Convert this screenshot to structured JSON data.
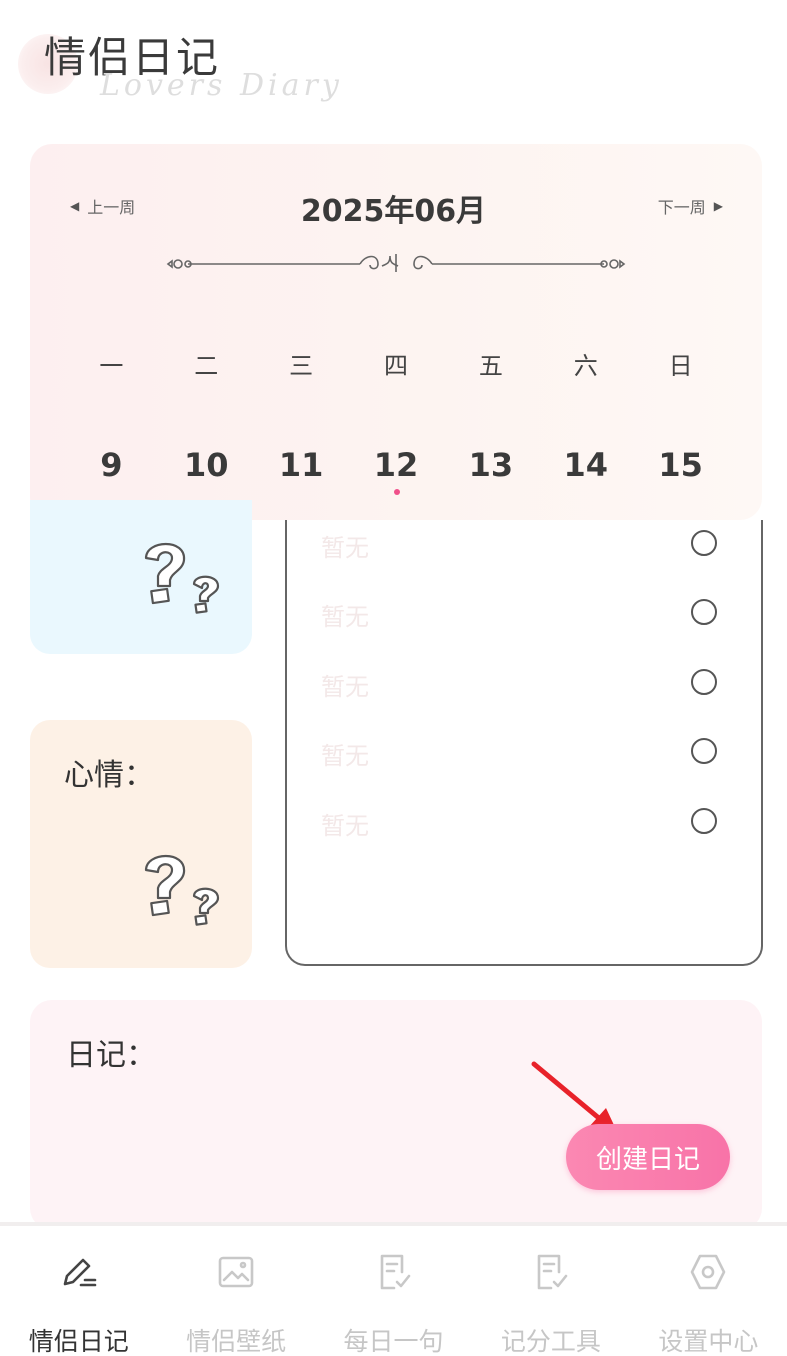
{
  "header": {
    "title": "情侣日记",
    "subtitle": "Lovers Diary"
  },
  "calendar": {
    "prev_week": "上一周",
    "next_week": "下一周",
    "month": "2025年06月",
    "weekdays": [
      "一",
      "二",
      "三",
      "四",
      "五",
      "六",
      "日"
    ],
    "dates": [
      "9",
      "10",
      "11",
      "12",
      "13",
      "14",
      "15"
    ],
    "selected_date": "12"
  },
  "mood": {
    "label": "心情："
  },
  "todos": [
    {
      "text": "暂无",
      "checked": false
    },
    {
      "text": "暂无",
      "checked": false
    },
    {
      "text": "暂无",
      "checked": false
    },
    {
      "text": "暂无",
      "checked": false
    },
    {
      "text": "暂无",
      "checked": false
    }
  ],
  "diary": {
    "label": "日记：",
    "create_button": "创建日记"
  },
  "tabbar": {
    "items": [
      {
        "label": "情侣日记",
        "icon": "pencil-icon",
        "active": true
      },
      {
        "label": "情侣壁纸",
        "icon": "image-icon",
        "active": false
      },
      {
        "label": "每日一句",
        "icon": "note-check-icon",
        "active": false
      },
      {
        "label": "记分工具",
        "icon": "scorecard-icon",
        "active": false
      },
      {
        "label": "设置中心",
        "icon": "settings-icon",
        "active": false
      }
    ]
  },
  "colors": {
    "accent": "#f873a8",
    "today_dot": "#f0508a",
    "arrow": "#e8222a"
  }
}
